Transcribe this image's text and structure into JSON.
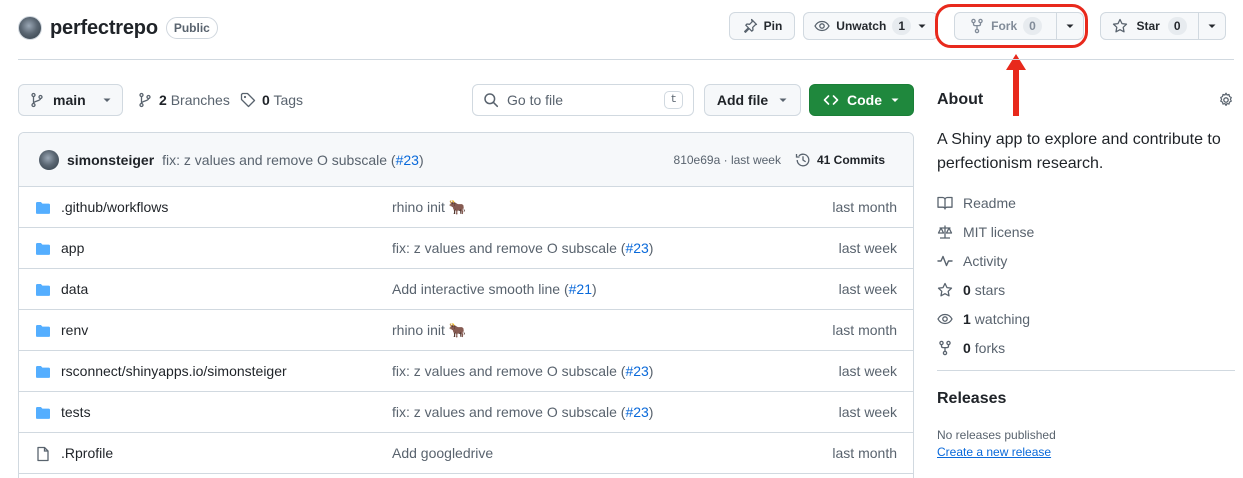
{
  "repo": {
    "name": "perfectrepo",
    "visibility": "Public"
  },
  "actions": {
    "pin_label": "Pin",
    "unwatch_label": "Unwatch",
    "unwatch_count": "1",
    "fork_label": "Fork",
    "fork_count": "0",
    "star_label": "Star",
    "star_count": "0"
  },
  "toolbar": {
    "branch": "main",
    "branches_count": "2",
    "branches_label": "Branches",
    "tags_count": "0",
    "tags_label": "Tags",
    "search_placeholder": "Go to file",
    "search_shortcut": "t",
    "add_file_label": "Add file",
    "code_label": "Code"
  },
  "latest_commit": {
    "author": "simonsteiger",
    "message": "fix: z values and remove O subscale (",
    "pr": "#23",
    "message_end": ")",
    "sha": "810e69a",
    "separator": "·",
    "time": "last week",
    "commits_label": "41 Commits"
  },
  "files": [
    {
      "type": "folder",
      "name": ".github/workflows",
      "message": "rhino init 🐂",
      "pr": "",
      "date": "last month"
    },
    {
      "type": "folder",
      "name": "app",
      "message": "fix: z values and remove O subscale (",
      "pr": "#23",
      "date": "last week"
    },
    {
      "type": "folder",
      "name": "data",
      "message": "Add interactive smooth line (",
      "pr": "#21",
      "date": "last week"
    },
    {
      "type": "folder",
      "name": "renv",
      "message": "rhino init 🐂",
      "pr": "",
      "date": "last month"
    },
    {
      "type": "folder",
      "name": "rsconnect/shinyapps.io/simonsteiger",
      "message": "fix: z values and remove O subscale (",
      "pr": "#23",
      "date": "last week"
    },
    {
      "type": "folder",
      "name": "tests",
      "message": "fix: z values and remove O subscale (",
      "pr": "#23",
      "date": "last week"
    },
    {
      "type": "file",
      "name": ".Rprofile",
      "message": "Add googledrive",
      "pr": "",
      "date": "last month"
    }
  ],
  "about": {
    "title": "About",
    "description": "A Shiny app to explore and contribute to perfectionism research.",
    "items": [
      {
        "icon": "book-icon",
        "bold": "",
        "label": "Readme"
      },
      {
        "icon": "law-icon",
        "bold": "",
        "label": "MIT license"
      },
      {
        "icon": "pulse-icon",
        "bold": "",
        "label": "Activity"
      },
      {
        "icon": "star-icon",
        "bold": "0",
        "label": "stars"
      },
      {
        "icon": "eye-icon",
        "bold": "1",
        "label": "watching"
      },
      {
        "icon": "fork-icon",
        "bold": "0",
        "label": "forks"
      }
    ]
  },
  "releases": {
    "title": "Releases",
    "none_text": "No releases published",
    "create_link": "Create a new release"
  },
  "colors": {
    "highlight": "#e8291c",
    "code_button": "#1f883d",
    "folder_icon": "#54aeff",
    "link": "#0969da"
  }
}
